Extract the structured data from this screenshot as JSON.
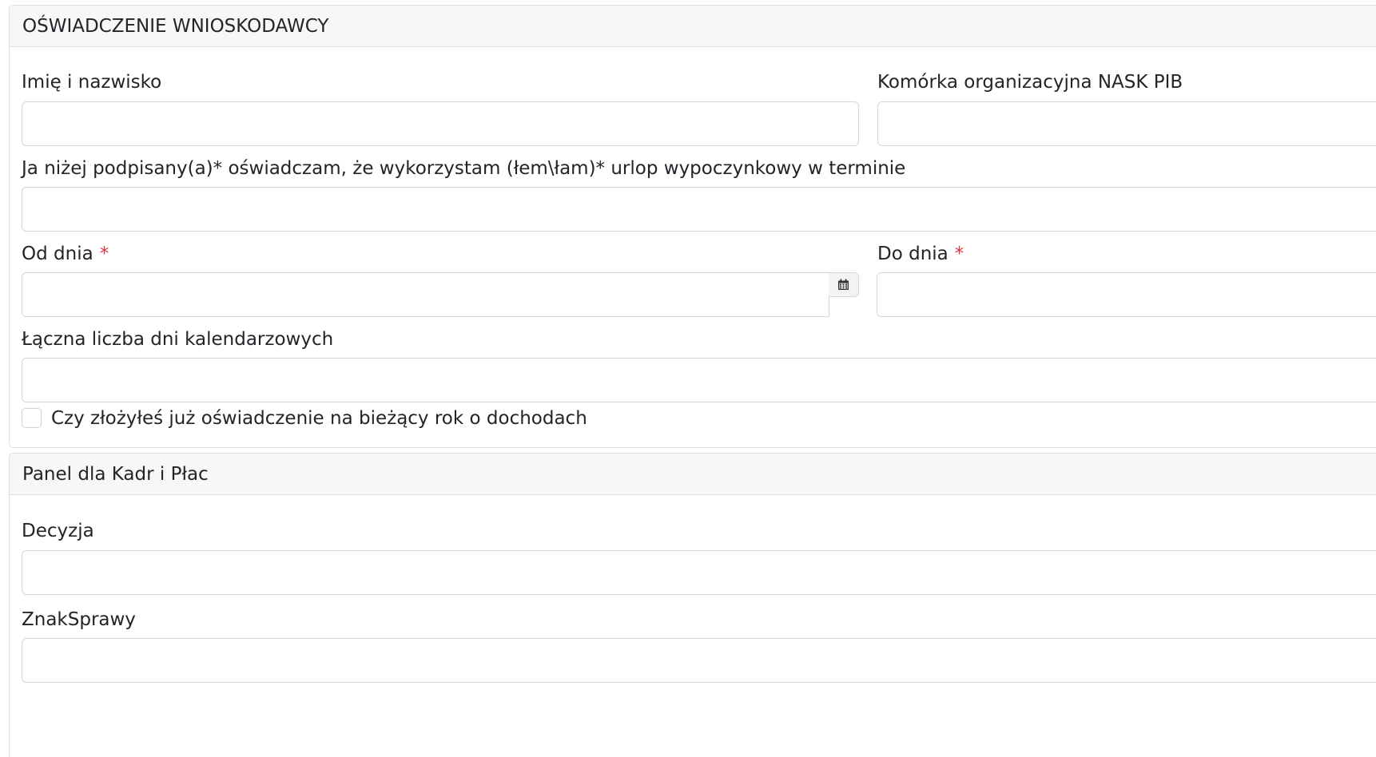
{
  "applicant_section": {
    "title": "OŚWIADCZENIE WNIOSKODAWCY",
    "full_name": {
      "label": "Imię i nazwisko",
      "value": ""
    },
    "department": {
      "label": "Komórka organizacyjna NASK PIB",
      "value": ""
    },
    "statement": {
      "label": "Ja niżej podpisany(a)* oświadczam, że wykorzystam (łem\\łam)* urlop wypoczynkowy w terminie",
      "value": ""
    },
    "date_from": {
      "label": "Od dnia",
      "required_mark": "*",
      "value": ""
    },
    "date_to": {
      "label": "Do dnia",
      "required_mark": "*",
      "value": ""
    },
    "total_days": {
      "label": "Łączna liczba dni kalendarzowych",
      "value": ""
    },
    "income_statement_checkbox": {
      "label": "Czy złożyłeś już oświadczenie na bieżący rok o dochodach",
      "checked": false
    }
  },
  "hr_section": {
    "title": "Panel dla Kadr i Płac",
    "decision": {
      "label": "Decyzja",
      "value": ""
    },
    "case_number": {
      "label": "ZnakSprawy",
      "value": ""
    }
  },
  "icons": {
    "calendar": "calendar-icon"
  }
}
